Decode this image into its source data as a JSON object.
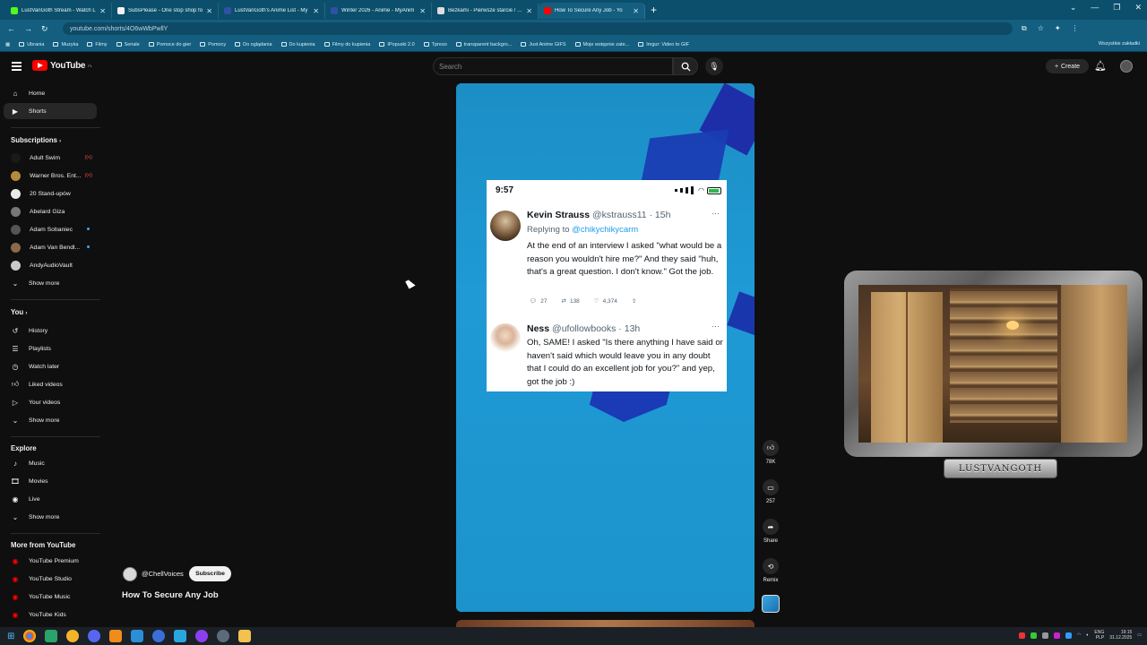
{
  "browser": {
    "tabs": [
      {
        "title": "LustVanGoth Stream - Watch L",
        "color": "#53fc18"
      },
      {
        "title": "SubsPlease - One stop shop fo",
        "color": "#f2f2f2"
      },
      {
        "title": "LustVanGoth's Anime List - My",
        "color": "#2e51a2"
      },
      {
        "title": "Winter 2026 - Anime - MyAnim",
        "color": "#2e51a2"
      },
      {
        "title": "Bezkami - Pierwsze starcie / Th",
        "color": "#dddddd"
      },
      {
        "title": "How To Secure Any Job - Yo",
        "color": "#ff0000"
      }
    ],
    "url": "youtube.com/shorts/4O6wWbPwllY",
    "bookmarks": [
      "Ubrania",
      "Muzyka",
      "Filmy",
      "Seriale",
      "Pomoce do gier",
      "Pomocy",
      "Do oglądania",
      "Do kupienia",
      "Filmy do kupienia",
      "IPopuski 2.0",
      "Tpreso",
      "transparent backgro...",
      "Just Anime GIFS",
      "Moje wstępnie zate...",
      "Imgur: Video to GIF"
    ],
    "bookmarks_right": "Wszystkie zakładki"
  },
  "header": {
    "logo_text": "YouTube",
    "logo_country": "PL",
    "search_placeholder": "Search",
    "create_label": "Create"
  },
  "sidebar": {
    "main": [
      {
        "label": "Home",
        "icon": "home-icon"
      },
      {
        "label": "Shorts",
        "icon": "shorts-icon"
      }
    ],
    "subscriptions_title": "Subscriptions",
    "subscriptions": [
      {
        "label": "Adult Swim",
        "color": "#1a1a1a",
        "badge": "live"
      },
      {
        "label": "Warner Bros. Ent...",
        "color": "#b58a3c",
        "badge": "live"
      },
      {
        "label": "20 Stand-upów",
        "color": "#e9e9e9",
        "badge": ""
      },
      {
        "label": "Abelard Giza",
        "color": "#777777",
        "badge": ""
      },
      {
        "label": "Adam Sobaniec",
        "color": "#555555",
        "badge": "dot"
      },
      {
        "label": "Adam Van Bendl...",
        "color": "#8a6a4a",
        "badge": "dot"
      },
      {
        "label": "AndyAudioVault",
        "color": "#c9c9c9",
        "badge": ""
      }
    ],
    "show_more": "Show more",
    "you_title": "You",
    "you": [
      {
        "label": "History",
        "icon": "history-icon"
      },
      {
        "label": "Playlists",
        "icon": "playlists-icon"
      },
      {
        "label": "Watch later",
        "icon": "clock-icon"
      },
      {
        "label": "Liked videos",
        "icon": "thumbs-up-icon"
      },
      {
        "label": "Your videos",
        "icon": "video-icon"
      }
    ],
    "explore_title": "Explore",
    "explore": [
      {
        "label": "Music",
        "icon": "music-icon"
      },
      {
        "label": "Movies",
        "icon": "movies-icon"
      },
      {
        "label": "Live",
        "icon": "live-icon"
      }
    ],
    "more_title": "More from YouTube",
    "more": [
      {
        "label": "YouTube Premium"
      },
      {
        "label": "YouTube Studio"
      },
      {
        "label": "YouTube Music"
      },
      {
        "label": "YouTube Kids"
      }
    ]
  },
  "short": {
    "tweets": [
      {
        "name": "Kevin Strauss",
        "handle": "@kstrauss11 · 15h",
        "replying": "Replying to",
        "replying_to": "@chikychikycarm",
        "text": "At the end of an interview I asked \"what would be a reason you wouldn't hire me?\" And they said \"huh, that's a great question. I don't know.\" Got the job.",
        "replies": "27",
        "retweets": "138",
        "likes": "4,374"
      },
      {
        "name": "Ness",
        "handle": "@ufollowbooks · 13h",
        "text": "Oh, SAME! I asked \"Is there anything I have said or haven't said which would leave you in any doubt that I could do an excellent job for you?\" and yep, got the job :)"
      }
    ],
    "phone_time": "9:57",
    "channel": "@ChellVoices",
    "subscribe_label": "Subscribe",
    "title": "How To Secure Any Job",
    "actions": {
      "likes": "78K",
      "comments": "257",
      "share": "Share",
      "remix": "Remix"
    }
  },
  "overlay": {
    "nameplate": "LUSTVANGOTH"
  },
  "taskbar": {
    "lang": "ENG",
    "lang2": "PLP",
    "time": "19:15",
    "date": "31.12.2025"
  }
}
